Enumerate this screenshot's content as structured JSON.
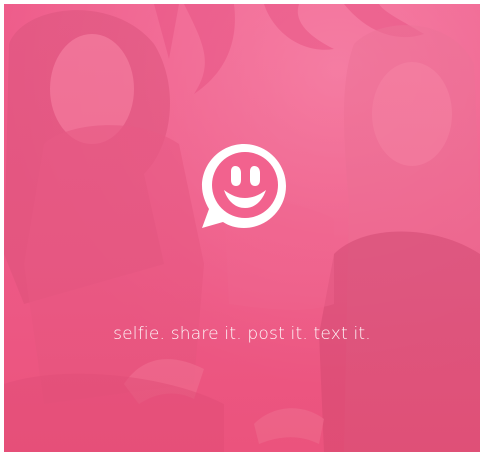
{
  "splash": {
    "tagline": "selfie. share it. post it. text it.",
    "logo_icon": "smiley-chat-bubble-icon",
    "background": "two-smiling-girls-photo",
    "accent_color": "#f2628e",
    "logo_color": "#ffffff"
  }
}
